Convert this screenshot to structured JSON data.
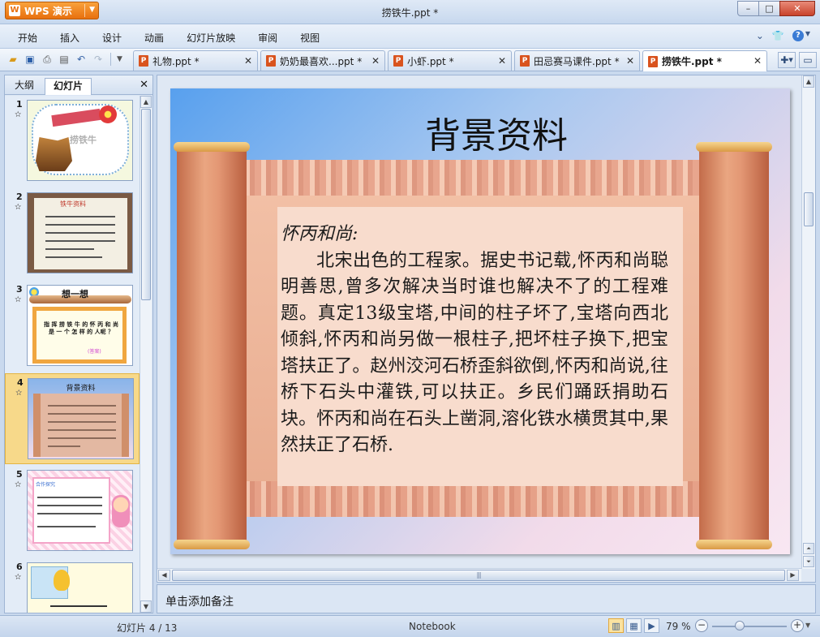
{
  "app": {
    "button_label": "WPS 演示",
    "logo_letter": "W",
    "window_title": "捞铁牛.ppt *"
  },
  "window_controls": {
    "minimize": "–",
    "maximize": "□",
    "close": "✕"
  },
  "menu": {
    "items": [
      "开始",
      "插入",
      "设计",
      "动画",
      "幻灯片放映",
      "审阅",
      "视图"
    ],
    "help": "?"
  },
  "tabs": [
    {
      "label": "礼物.ppt *",
      "active": false
    },
    {
      "label": "奶奶最喜欢...ppt *",
      "active": false
    },
    {
      "label": "小虾.ppt *",
      "active": false
    },
    {
      "label": "田忌赛马课件.ppt *",
      "active": false
    },
    {
      "label": "捞铁牛.ppt *",
      "active": true
    }
  ],
  "left_panel": {
    "tab_outline": "大纲",
    "tab_slides": "幻灯片",
    "slide_numbers": [
      "1",
      "2",
      "3",
      "4",
      "5",
      "6"
    ],
    "selected_slide": 4,
    "thumb1_title": "捞铁牛",
    "thumb2_title": "铁牛资料",
    "thumb3_header": "想一想",
    "thumb3_question": "指 挥 捞 铁 牛 的 怀 丙 和 尚 是 一 个 怎 样 的 人呢 ？",
    "thumb3_answer": "(答案)",
    "thumb4_title": "背景资料",
    "thumb5_title": "合作探究"
  },
  "slide": {
    "title": "背景资料",
    "lead": "怀丙和尚:",
    "body": "北宋出色的工程家。据史书记载,怀丙和尚聪明善思,曾多次解决当时谁也解决不了的工程难题。真定13级宝塔,中间的柱子坏了,宝塔向西北倾斜,怀丙和尚另做一根柱子,把坏柱子换下,把宝塔扶正了。赵州洨河石桥歪斜欲倒,怀丙和尚说,往桥下石头中灌铁,可以扶正。乡民们踊跃捐助石块。怀丙和尚在石头上凿洞,溶化铁水横贯其中,果然扶正了石桥."
  },
  "notes": {
    "placeholder": "单击添加备注"
  },
  "status": {
    "slide_indicator": "幻灯片 4 / 13",
    "theme": "Notebook",
    "zoom": "79 %",
    "zoom_value": 0.79
  },
  "colors": {
    "app_button": "#e8700e",
    "selected_thumb": "#f7d98a",
    "ui_blue": "#c9d9ee"
  }
}
